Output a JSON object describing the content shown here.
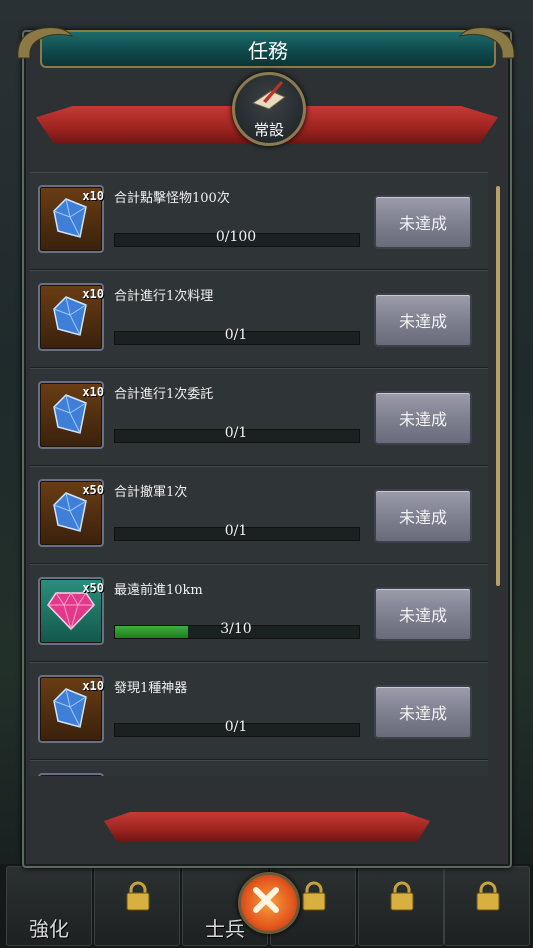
{
  "dialog": {
    "title": "任務",
    "category_label": "常設"
  },
  "tasks": [
    {
      "title": "合計點擊怪物100次",
      "qty": "x10",
      "progress_text": "0/100",
      "progress": 0,
      "reward": "blue-crystal-icon",
      "button": "未達成"
    },
    {
      "title": "合計進行1次料理",
      "qty": "x10",
      "progress_text": "0/1",
      "progress": 0,
      "reward": "blue-crystal-icon",
      "button": "未達成"
    },
    {
      "title": "合計進行1次委託",
      "qty": "x10",
      "progress_text": "0/1",
      "progress": 0,
      "reward": "blue-crystal-icon",
      "button": "未達成"
    },
    {
      "title": "合計撤軍1次",
      "qty": "x50",
      "progress_text": "0/1",
      "progress": 0,
      "reward": "blue-crystal-icon",
      "button": "未達成"
    },
    {
      "title": "最遠前進10km",
      "qty": "x50",
      "progress_text": "3/10",
      "progress": 0.3,
      "reward": "pink-gem-icon",
      "button": "未達成"
    },
    {
      "title": "發現1種神器",
      "qty": "x10",
      "progress_text": "0/1",
      "progress": 0,
      "reward": "blue-crystal-icon",
      "button": "未達成"
    }
  ],
  "bottom_tabs": [
    {
      "label": "強化",
      "locked": false
    },
    {
      "label": "",
      "locked": true
    },
    {
      "label": "士兵",
      "locked": false
    },
    {
      "label": "",
      "locked": true
    },
    {
      "label": "",
      "locked": true
    },
    {
      "label": "",
      "locked": true
    }
  ],
  "colors": {
    "progress_fill": "#3fae3c",
    "ribbon": "#c83a34",
    "title_bar": "#1d6b6b"
  }
}
